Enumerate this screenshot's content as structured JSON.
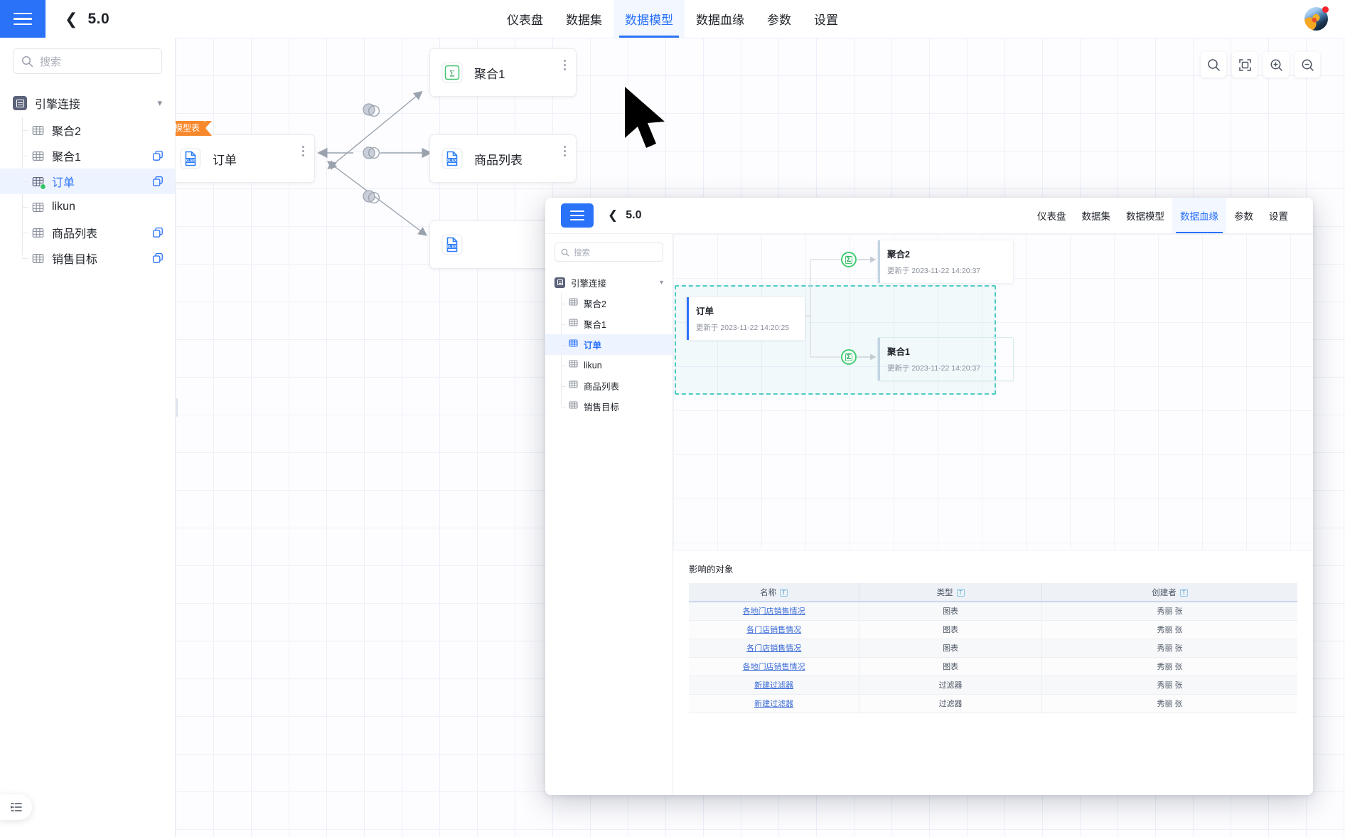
{
  "app": {
    "version_label": "5.0",
    "back_icon": "chevron-left-icon",
    "menu_icon": "hamburger-menu-icon"
  },
  "topnav": {
    "items": [
      {
        "label": "仪表盘",
        "active": false
      },
      {
        "label": "数据集",
        "active": false
      },
      {
        "label": "数据模型",
        "active": true
      },
      {
        "label": "数据血缘",
        "active": false
      },
      {
        "label": "参数",
        "active": false
      },
      {
        "label": "设置",
        "active": false
      }
    ]
  },
  "sidebar": {
    "search_placeholder": "搜索",
    "root": {
      "label": "引擎连接",
      "icon": "database-icon",
      "caret": "chevron-down-icon"
    },
    "items": [
      {
        "label": "聚合2",
        "icon": "table-icon",
        "selected": false,
        "has_copy": false,
        "online": false
      },
      {
        "label": "聚合1",
        "icon": "table-icon",
        "selected": false,
        "has_copy": true,
        "online": false
      },
      {
        "label": "订单",
        "icon": "table-icon",
        "selected": true,
        "has_copy": true,
        "online": true
      },
      {
        "label": "likun",
        "icon": "table-icon",
        "selected": false,
        "has_copy": false,
        "online": false
      },
      {
        "label": "商品列表",
        "icon": "table-icon",
        "selected": false,
        "has_copy": true,
        "online": false
      },
      {
        "label": "销售目标",
        "icon": "table-icon",
        "selected": false,
        "has_copy": true,
        "online": false
      }
    ],
    "panel_toggle_icon": "panel-expand-icon"
  },
  "canvas": {
    "tools": [
      {
        "name": "search-icon",
        "label": "搜索"
      },
      {
        "name": "fit-screen-icon",
        "label": "适应屏幕"
      },
      {
        "name": "zoom-in-icon",
        "label": "放大"
      },
      {
        "name": "zoom-out-icon",
        "label": "缩小"
      }
    ],
    "nodes": [
      {
        "title": "聚合1",
        "icon": "sigma-icon",
        "badge": null
      },
      {
        "title": "订单",
        "icon": "xlsx-file-icon",
        "badge": "模型表"
      },
      {
        "title": "商品列表",
        "icon": "xlsx-file-icon",
        "badge": null
      },
      {
        "title": "",
        "icon": "xlsx-file-icon",
        "badge": null
      }
    ],
    "join_icon": "venn-join-icon"
  },
  "inner_window": {
    "version_label": "5.0",
    "topnav": {
      "items": [
        {
          "label": "仪表盘",
          "active": false
        },
        {
          "label": "数据集",
          "active": false
        },
        {
          "label": "数据模型",
          "active": false
        },
        {
          "label": "数据血缘",
          "active": true
        },
        {
          "label": "参数",
          "active": false
        },
        {
          "label": "设置",
          "active": false
        }
      ]
    },
    "sidebar": {
      "search_placeholder": "搜索",
      "root": {
        "label": "引擎连接",
        "icon": "database-icon",
        "caret": "chevron-down-icon"
      },
      "items": [
        {
          "label": "聚合2",
          "selected": false
        },
        {
          "label": "聚合1",
          "selected": false
        },
        {
          "label": "订单",
          "selected": true
        },
        {
          "label": "likun",
          "selected": false
        },
        {
          "label": "商品列表",
          "selected": false
        },
        {
          "label": "销售目标",
          "selected": false
        }
      ]
    },
    "lineage": {
      "nodes": [
        {
          "id": "juhe2",
          "title": "聚合2",
          "meta": "更新于 2023-11-22 14:20:37"
        },
        {
          "id": "dingdan",
          "title": "订单",
          "meta": "更新于 2023-11-22 14:20:25"
        },
        {
          "id": "juhe1",
          "title": "聚合1",
          "meta": "更新于 2023-11-22 14:20:37"
        }
      ],
      "aggregate_icon": "sigma-icon"
    },
    "affected": {
      "title": "影响的对象",
      "columns": [
        {
          "label": "名称",
          "filter_icon": "text-filter-icon"
        },
        {
          "label": "类型",
          "filter_icon": "text-filter-icon"
        },
        {
          "label": "创建者",
          "filter_icon": "text-filter-icon"
        }
      ],
      "rows": [
        {
          "name": "各地门店销售情况",
          "type": "图表",
          "creator": "秀丽 张"
        },
        {
          "name": "各门店销售情况",
          "type": "图表",
          "creator": "秀丽 张"
        },
        {
          "name": "各门店销售情况",
          "type": "图表",
          "creator": "秀丽 张"
        },
        {
          "name": "各地门店销售情况",
          "type": "图表",
          "creator": "秀丽 张"
        },
        {
          "name": "新建过滤器",
          "type": "过滤器",
          "creator": "秀丽 张"
        },
        {
          "name": "新建过滤器",
          "type": "过滤器",
          "creator": "秀丽 张"
        }
      ]
    }
  },
  "colors": {
    "brand": "#2a72f8",
    "accent_orange": "#f7882b",
    "accent_green": "#41cc74",
    "selection": "#4ecdc4"
  }
}
